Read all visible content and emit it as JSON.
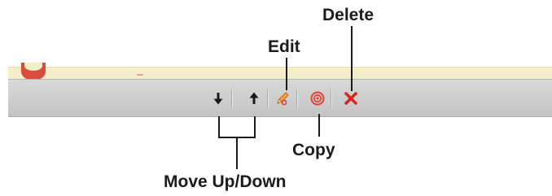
{
  "toolbar": {
    "buttons": [
      {
        "name": "move-down",
        "icon": "arrow-down-icon"
      },
      {
        "name": "move-up",
        "icon": "arrow-up-icon"
      },
      {
        "name": "edit",
        "icon": "pencil-icon"
      },
      {
        "name": "copy",
        "icon": "copy-target-icon"
      },
      {
        "name": "delete",
        "icon": "close-x-icon"
      }
    ]
  },
  "callouts": {
    "delete": "Delete",
    "edit": "Edit",
    "copy": "Copy",
    "move": "Move Up/Down"
  },
  "colors": {
    "toolbar_bg": "#cfcfcf",
    "content_strip": "#f6eec9",
    "delete_red": "#d8261c",
    "copy_red": "#e2403a",
    "edit_orange": "#e5822c",
    "callout_text": "#1b1b1b"
  }
}
